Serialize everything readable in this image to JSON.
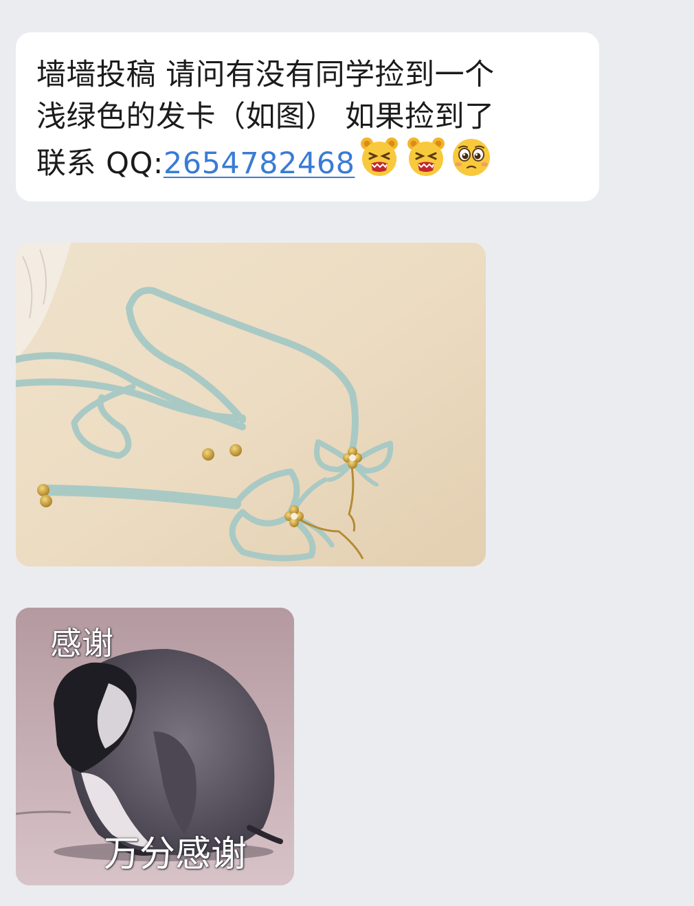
{
  "message": {
    "lines": [
      "墙墙投稿 请问有没有同学捡到一个",
      "浅绿色的发卡（如图） 如果捡到了"
    ],
    "contact_prefix": "联系 QQ:",
    "qq_number": "2654782468",
    "emojis": [
      "grimace-face-icon",
      "grimace-face-icon",
      "pleading-face-icon"
    ]
  },
  "sticker": {
    "caption_top": "感谢",
    "caption_bottom": "万分感谢"
  },
  "colors": {
    "background": "#ebecf0",
    "bubble": "#ffffff",
    "link": "#3a7bd5",
    "ribbon": "#a9c9c4"
  }
}
